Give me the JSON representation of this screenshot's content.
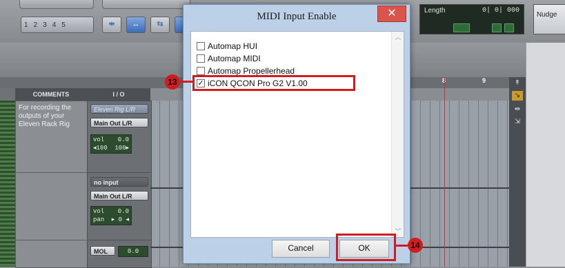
{
  "background": {
    "transport_numbers": [
      "1",
      "2",
      "3",
      "4",
      "5"
    ],
    "length_label": "Length",
    "length_value": "0| 0| 000",
    "nudge_label": "Nudge",
    "columns": {
      "comments": "COMMENTS",
      "io": "I / O"
    },
    "ruler_marks": [
      "8",
      "9"
    ],
    "track1": {
      "comment": "For recording the outputs of your Eleven Rack Rig",
      "input": "Eleven Rig L/R",
      "output": "Main Out L/R",
      "vol_label": "vol",
      "vol_value": "0.0",
      "pan_left": "◂100",
      "pan_right": "100▸"
    },
    "track2": {
      "input": "no input",
      "output": "Main Out L/R",
      "vol_label": "vol",
      "vol_value": "0.0",
      "pan_label": "pan",
      "pan_value": "▸ 0 ◂"
    },
    "track3": {
      "output": "MOL",
      "vol_value": "0.0"
    }
  },
  "dialog": {
    "title": "MIDI Input Enable",
    "close_glyph": "✕",
    "items": [
      {
        "label": "Automap HUI",
        "checked": false
      },
      {
        "label": "Automap MIDI",
        "checked": false
      },
      {
        "label": "Automap Propellerhead",
        "checked": false
      },
      {
        "label": "iCON QCON Pro G2 V1.00",
        "checked": true
      }
    ],
    "check_glyph": "✓",
    "cancel_label": "Cancel",
    "ok_label": "OK"
  },
  "annotations": {
    "step_13": "13",
    "step_14": "14",
    "color": "#d01c1f"
  }
}
